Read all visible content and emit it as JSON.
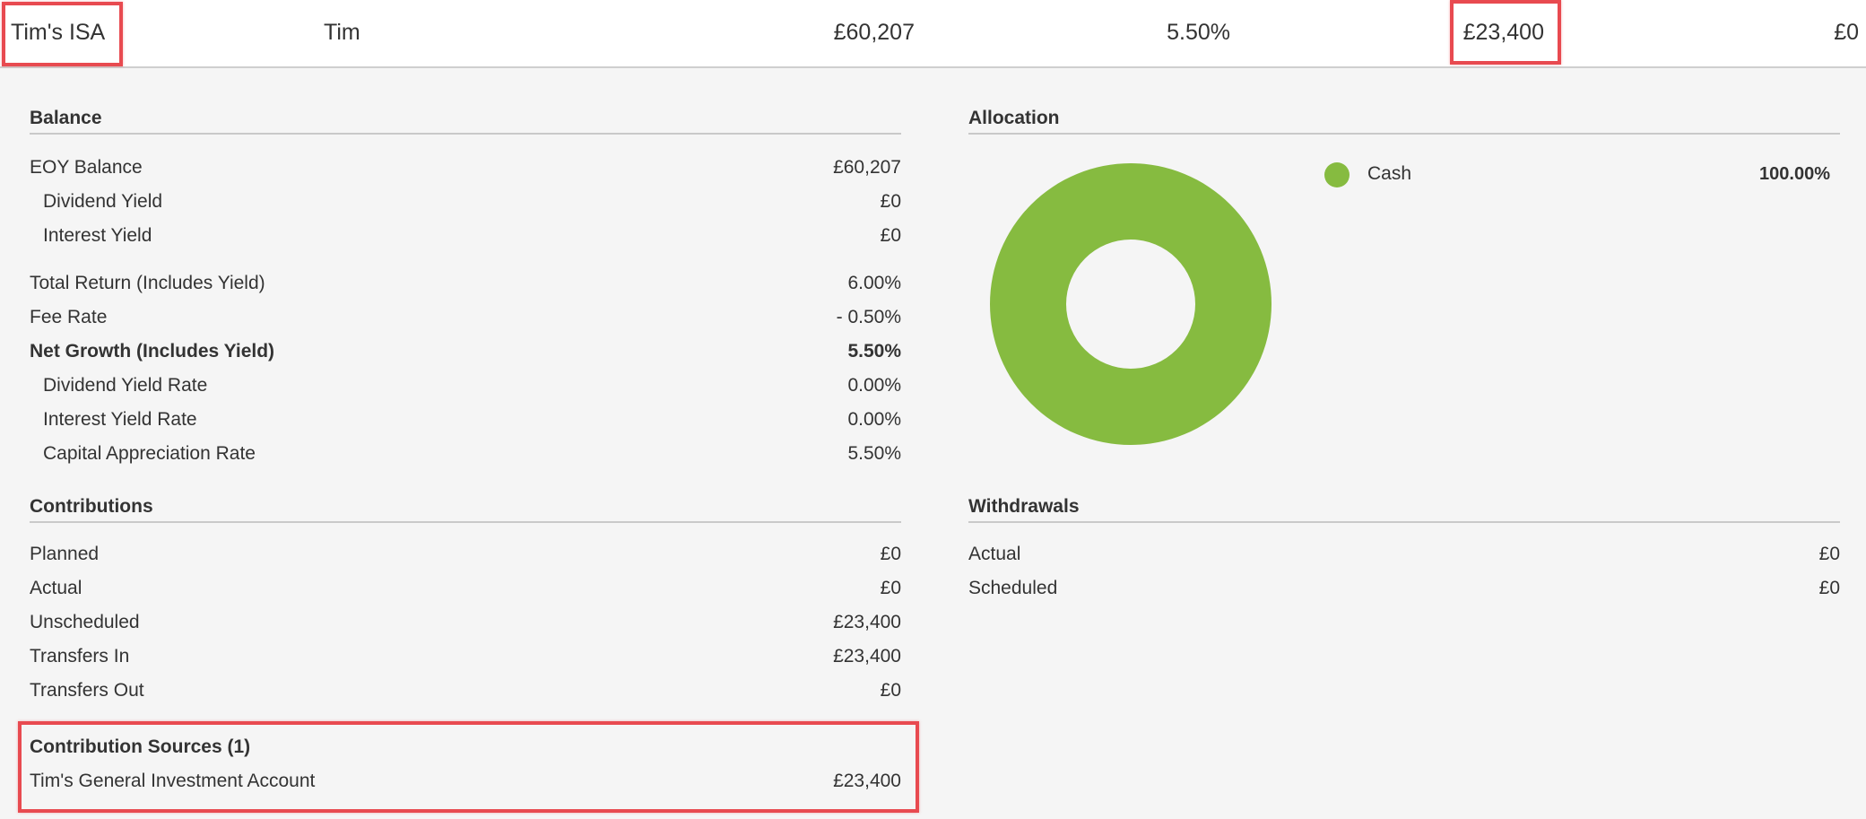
{
  "header": {
    "account_name": "Tim's ISA",
    "owner": "Tim",
    "balance": "£60,207",
    "net_growth": "5.50%",
    "contributions": "£23,400",
    "withdrawals": "£0"
  },
  "balance": {
    "title": "Balance",
    "rows": [
      {
        "label": "EOY Balance",
        "value": "£60,207"
      },
      {
        "label": "Dividend Yield",
        "value": "£0"
      },
      {
        "label": "Interest Yield",
        "value": "£0"
      },
      {
        "label": "Total Return (Includes Yield)",
        "value": "6.00%"
      },
      {
        "label": "Fee Rate",
        "value": "- 0.50%"
      },
      {
        "label": "Net Growth (Includes Yield)",
        "value": "5.50%"
      },
      {
        "label": "Dividend Yield Rate",
        "value": "0.00%"
      },
      {
        "label": "Interest Yield Rate",
        "value": "0.00%"
      },
      {
        "label": "Capital Appreciation Rate",
        "value": "5.50%"
      }
    ]
  },
  "contributions": {
    "title": "Contributions",
    "rows": [
      {
        "label": "Planned",
        "value": "£0"
      },
      {
        "label": "Actual",
        "value": "£0"
      },
      {
        "label": "Unscheduled",
        "value": "£23,400"
      },
      {
        "label": "Transfers In",
        "value": "£23,400"
      },
      {
        "label": "Transfers Out",
        "value": "£0"
      }
    ]
  },
  "contribution_sources": {
    "title": "Contribution Sources (1)",
    "rows": [
      {
        "label": "Tim's General Investment Account",
        "value": "£23,400"
      }
    ]
  },
  "allocation": {
    "title": "Allocation",
    "items": [
      {
        "name": "Cash",
        "percent": "100.00%",
        "fraction": 1.0,
        "color": "#86bb40"
      }
    ]
  },
  "withdrawals": {
    "title": "Withdrawals",
    "rows": [
      {
        "label": "Actual",
        "value": "£0"
      },
      {
        "label": "Scheduled",
        "value": "£0"
      }
    ]
  },
  "colors": {
    "highlight": "#e84a50",
    "accent_green": "#86bb40"
  }
}
